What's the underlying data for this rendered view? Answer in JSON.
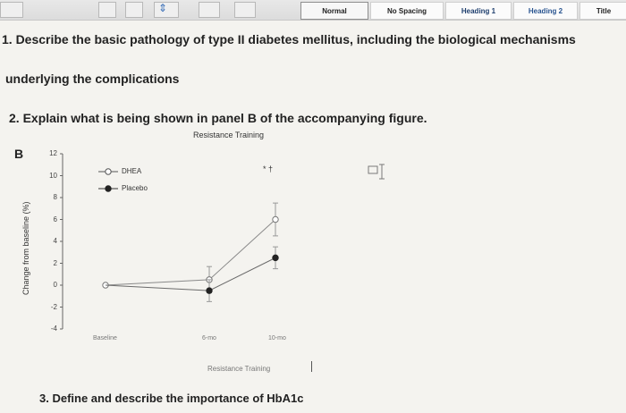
{
  "ribbon": {
    "styles": [
      "Normal",
      "No Spacing",
      "Heading 1",
      "Heading 2",
      "Title"
    ]
  },
  "document": {
    "q1_line1": "1. Describe the basic pathology of type II diabetes mellitus, including the biological mechanisms",
    "q1_line2": "underlying the complications",
    "q2": "2. Explain what is being shown in panel B of the accompanying figure.",
    "q3": "3. Define and describe the importance of HbA1c"
  },
  "figure": {
    "panel_letter": "B",
    "title": "Resistance Training",
    "significance_mark": "* †"
  },
  "chart_data": {
    "type": "line",
    "title": "Resistance Training",
    "xlabel": "Resistance Training",
    "ylabel": "Change from baseline (%)",
    "categories": [
      "Baseline",
      "6-mo",
      "10-mo"
    ],
    "yticks": [
      12,
      10,
      8,
      6,
      4,
      2,
      0,
      -2,
      -4
    ],
    "ylim": [
      -4,
      12
    ],
    "legend_position": "top-left",
    "series": [
      {
        "name": "DHEA",
        "marker": "open-circle",
        "values": [
          0,
          0.5,
          6
        ],
        "error": [
          0,
          1.2,
          1.5
        ]
      },
      {
        "name": "Placebo",
        "marker": "filled-circle",
        "values": [
          0,
          -0.5,
          2.5
        ],
        "error": [
          0,
          1.0,
          1.0
        ]
      }
    ]
  }
}
